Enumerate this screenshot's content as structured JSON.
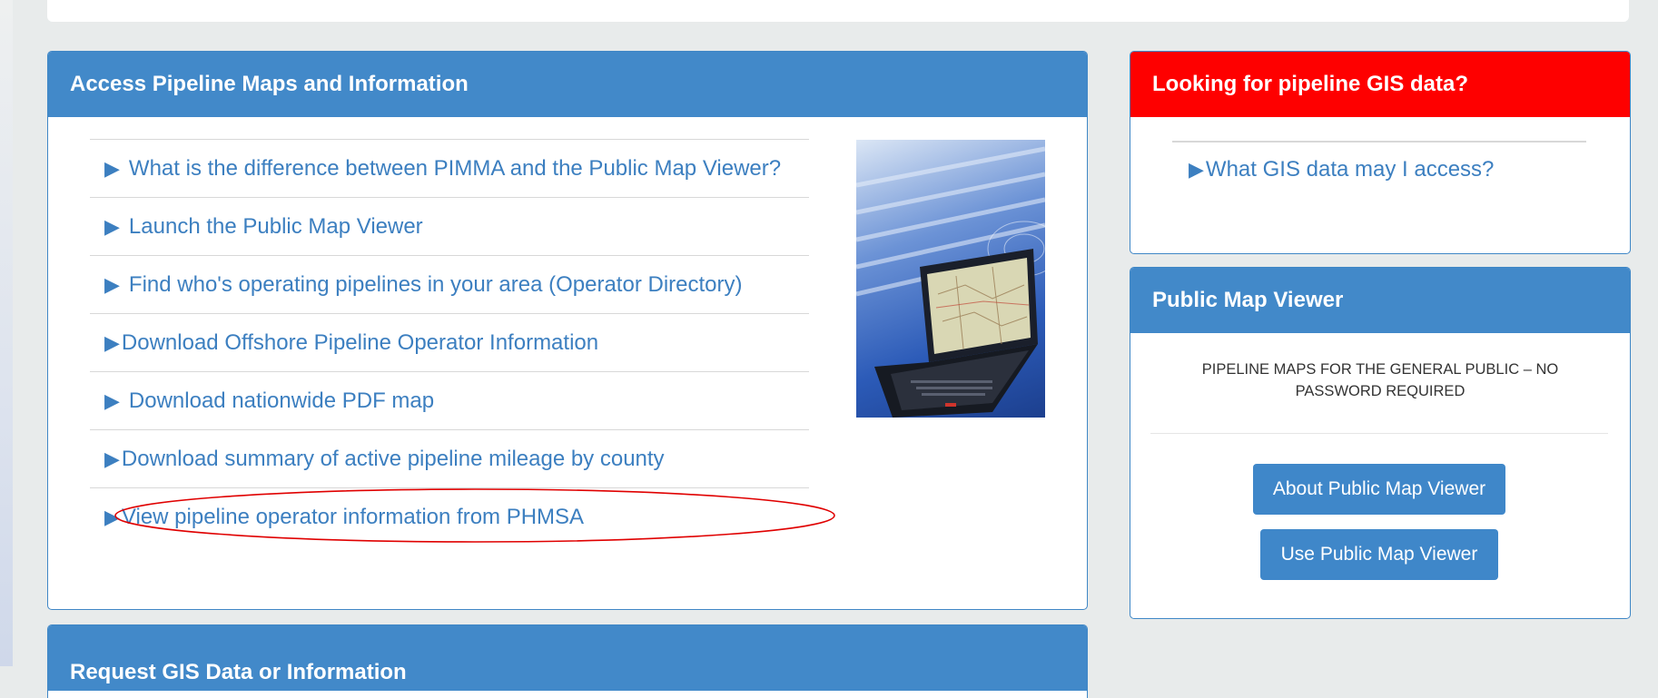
{
  "main_panel": {
    "title": "Access Pipeline Maps and Information",
    "links": [
      {
        "label": "What is the difference between PIMMA and the Public Map Viewer?"
      },
      {
        "label": "Launch the Public Map Viewer"
      },
      {
        "label": "Find who's operating pipelines in your area (Operator Directory)"
      },
      {
        "label": "Download Offshore Pipeline Operator Information"
      },
      {
        "label": "Download nationwide PDF map"
      },
      {
        "label": "Download summary of active pipeline mileage by county"
      },
      {
        "label": "View pipeline operator information from PHMSA"
      }
    ]
  },
  "gis_panel": {
    "title": "Looking for pipeline GIS data?",
    "link": "What GIS data may I access?"
  },
  "pmv_panel": {
    "title": "Public Map Viewer",
    "description": "PIPELINE MAPS FOR THE GENERAL PUBLIC – NO PASSWORD REQUIRED",
    "about_button": "About Public Map Viewer",
    "use_button": "Use Public Map Viewer"
  },
  "request_panel": {
    "title": "Request GIS Data or Information"
  },
  "colors": {
    "header_blue": "#4289c9",
    "header_red": "#fe0000",
    "link_blue": "#3c7fc0",
    "annotation_red": "#e00000"
  },
  "icons": {
    "link_bullet": "caret-right-icon"
  }
}
